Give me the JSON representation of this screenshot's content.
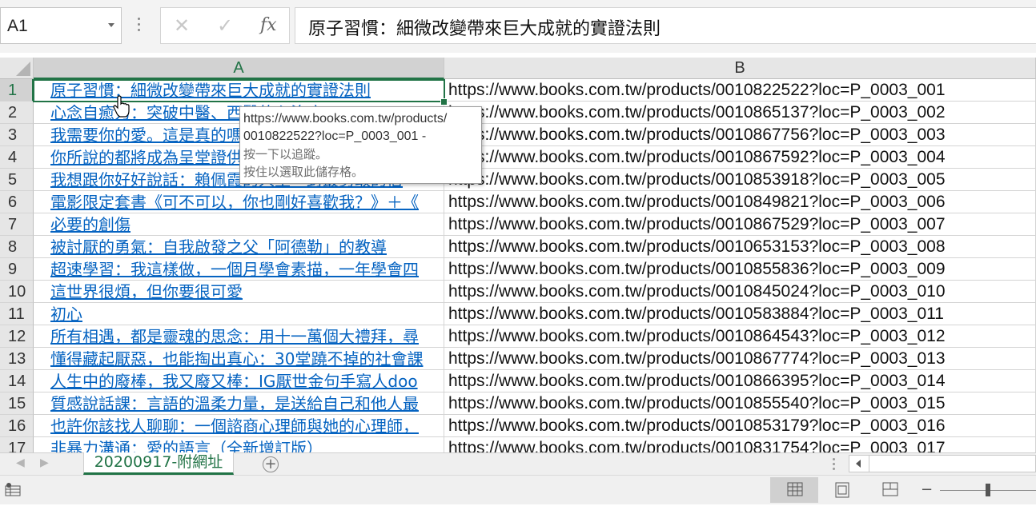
{
  "formula_bar": {
    "name_box": "A1",
    "cancel_glyph": "✕",
    "enter_glyph": "✓",
    "fx_label": "fx",
    "formula": "原子習慣：細微改變帶來巨大成就的實證法則"
  },
  "columns": [
    "A",
    "B"
  ],
  "selected_column": "A",
  "selected_row": "1",
  "rows": [
    {
      "row": "1",
      "a": "原子習慣：細微改變帶來巨大成就的實證法則",
      "b": "https://www.books.com.tw/products/0010822522?loc=P_0003_001"
    },
    {
      "row": "2",
      "a": "心念自癒力：突破中醫、西醫的心治療",
      "b": "https://www.books.com.tw/products/0010865137?loc=P_0003_002"
    },
    {
      "row": "3",
      "a": "我需要你的愛。這是真的嗎？",
      "b": "https://www.books.com.tw/products/0010867756?loc=P_0003_003"
    },
    {
      "row": "4",
      "a": "你所說的都將成為呈堂證供",
      "b": "https://www.books.com.tw/products/0010867592?loc=P_0003_004"
    },
    {
      "row": "5",
      "a": "我想跟你好好說話：賴佩霞的人生一封最勇敢的信",
      "b": "https://www.books.com.tw/products/0010853918?loc=P_0003_005"
    },
    {
      "row": "6",
      "a": "電影限定套書《可不可以，你也剛好喜歡我？》＋《",
      "b": "https://www.books.com.tw/products/0010849821?loc=P_0003_006"
    },
    {
      "row": "7",
      "a": "必要的創傷",
      "b": "https://www.books.com.tw/products/0010867529?loc=P_0003_007"
    },
    {
      "row": "8",
      "a": "被討厭的勇氣：自我啟發之父「阿德勒」的教導",
      "b": "https://www.books.com.tw/products/0010653153?loc=P_0003_008"
    },
    {
      "row": "9",
      "a": "超速學習：我這樣做，一個月學會素描，一年學會四",
      "b": "https://www.books.com.tw/products/0010855836?loc=P_0003_009"
    },
    {
      "row": "10",
      "a": "這世界很煩，但你要很可愛",
      "b": "https://www.books.com.tw/products/0010845024?loc=P_0003_010"
    },
    {
      "row": "11",
      "a": "初心",
      "b": "https://www.books.com.tw/products/0010583884?loc=P_0003_011"
    },
    {
      "row": "12",
      "a": "所有相遇，都是靈魂的思念：用十一萬個大禮拜，尋",
      "b": "https://www.books.com.tw/products/0010864543?loc=P_0003_012"
    },
    {
      "row": "13",
      "a": "懂得藏起厭惡，也能掏出真心：30堂蹺不掉的社會課",
      "b": "https://www.books.com.tw/products/0010867774?loc=P_0003_013"
    },
    {
      "row": "14",
      "a": "人生中的廢棒，我又廢又棒：IG厭世金句手寫人doo",
      "b": "https://www.books.com.tw/products/0010866395?loc=P_0003_014"
    },
    {
      "row": "15",
      "a": "質感說話課：言語的溫柔力量，是送給自己和他人最",
      "b": "https://www.books.com.tw/products/0010855540?loc=P_0003_015"
    },
    {
      "row": "16",
      "a": "也許你該找人聊聊：一個諮商心理師與她的心理師，",
      "b": "https://www.books.com.tw/products/0010853179?loc=P_0003_016"
    },
    {
      "row": "17",
      "a": "非暴力溝通：愛的語言（全新增訂版）",
      "b": "https://www.books.com.tw/products/0010831754?loc=P_0003_017"
    }
  ],
  "tooltip": {
    "line1": "https://www.books.com.tw/products/",
    "line2": "0010822522?loc=P_0003_001 -",
    "line3": "按一下以追蹤。",
    "line4": "按住以選取此儲存格。"
  },
  "sheet_tabs": {
    "active": "20200917-附網址",
    "add_glyph": "+",
    "prev_glyph": "◀",
    "next_glyph": "▶"
  },
  "status_bar": {
    "zoom_minus": "−",
    "zoom_level_fraction": 0.5
  },
  "colors": {
    "accent": "#217346",
    "hyperlink": "#0563c1"
  }
}
